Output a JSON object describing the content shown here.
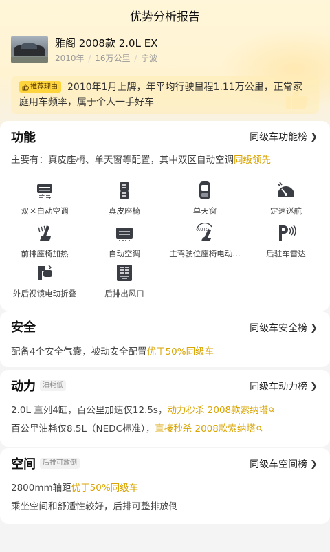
{
  "page": {
    "title": "优势分析报告"
  },
  "car": {
    "name": "雅阁 2008款 2.0L EX",
    "year": "2010年",
    "mileage": "16万公里",
    "city": "宁波"
  },
  "reason": {
    "badge": "推荐理由",
    "text": "2010年1月上牌，年平均行驶里程1.11万公里，正常家庭用车频率，属于个人一手好车"
  },
  "function": {
    "title": "功能",
    "link": "同级车功能榜",
    "desc_prefix": "主要有：真皮座椅、单天窗等配置，其中双区自动空调",
    "desc_highlight": "同级领先",
    "features": [
      {
        "label": "双区自动空调",
        "icon": "dual-zone-ac-icon"
      },
      {
        "label": "真皮座椅",
        "icon": "leather-seat-icon"
      },
      {
        "label": "单天窗",
        "icon": "sunroof-icon"
      },
      {
        "label": "定速巡航",
        "icon": "cruise-control-icon"
      },
      {
        "label": "前排座椅加热",
        "icon": "seat-heating-icon"
      },
      {
        "label": "自动空调",
        "icon": "auto-ac-icon"
      },
      {
        "label": "主驾驶位座椅电动…",
        "icon": "power-seat-icon"
      },
      {
        "label": "后驻车雷达",
        "icon": "parking-radar-icon"
      },
      {
        "label": "外后视镜电动折叠",
        "icon": "mirror-fold-icon"
      },
      {
        "label": "后排出风口",
        "icon": "rear-vent-icon"
      }
    ]
  },
  "safety": {
    "title": "安全",
    "link": "同级车安全榜",
    "desc_prefix": "配备4个安全气囊，被动安全配置",
    "desc_highlight": "优于50%同级车"
  },
  "power": {
    "title": "动力",
    "tag": "油耗低",
    "link": "同级车动力榜",
    "line1_prefix": "2.0L 直列4缸，百公里加速仅12.5s，",
    "line1_highlight": "动力秒杀 2008款索纳塔",
    "line2_prefix": "百公里油耗仅8.5L（NEDC标准），",
    "line2_highlight": "直接秒杀 2008款索纳塔"
  },
  "space": {
    "title": "空间",
    "tag": "后排可放倒",
    "link": "同级车空间榜",
    "line1_prefix": "2800mm轴距",
    "line1_highlight": "优于50%同级车",
    "line2": "乘坐空间和舒适性较好，后排可整排放倒"
  },
  "colors": {
    "accent": "#d9a400",
    "badge": "#ffd53d"
  }
}
